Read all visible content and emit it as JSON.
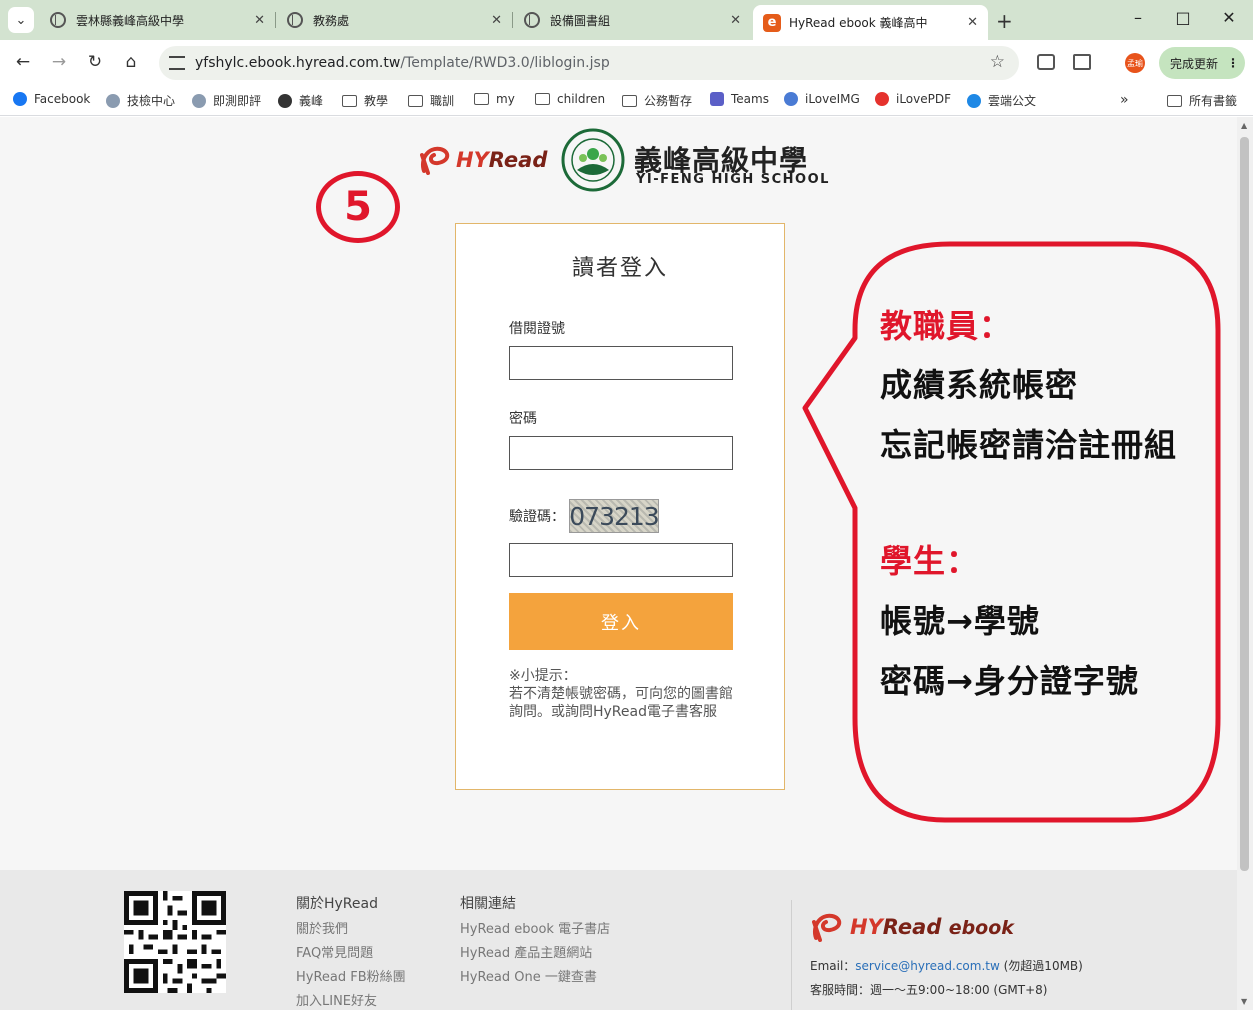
{
  "tabs": [
    {
      "label": "雲林縣義峰高級中學"
    },
    {
      "label": "教務處"
    },
    {
      "label": "設備圖書組"
    },
    {
      "label": "HyRead ebook 義峰高中",
      "icon": "e"
    }
  ],
  "window_buttons": {
    "minimize": "–",
    "maximize": "□",
    "close": "✕"
  },
  "toolbar": {
    "url_host": "yfshylc.ebook.hyread.com.tw",
    "url_path": "/Template/RWD3.0/liblogin.jsp",
    "profile_initials": "孟瑜",
    "update_label": "完成更新"
  },
  "bookmarks": [
    {
      "label": "Facebook",
      "color": "#1877f2"
    },
    {
      "label": "技檢中心",
      "color": "#8a9bb0"
    },
    {
      "label": "即測即評",
      "color": "#8a9bb0"
    },
    {
      "label": "義峰",
      "color": "#333333"
    },
    {
      "label": "教學",
      "type": "folder"
    },
    {
      "label": "職訓",
      "type": "folder"
    },
    {
      "label": "my",
      "type": "folder"
    },
    {
      "label": "children",
      "type": "folder"
    },
    {
      "label": "公務暫存",
      "type": "folder"
    },
    {
      "label": "Teams",
      "color": "#5b5fc7"
    },
    {
      "label": "iLoveIMG",
      "color": "#4a7bd4"
    },
    {
      "label": "iLovePDF",
      "color": "#e5322d"
    },
    {
      "label": "雲端公文",
      "color": "#1e88e5"
    }
  ],
  "bookmarks_overflow": "»",
  "bookmarks_all": "所有書籤",
  "header": {
    "hyread_hy": "HY",
    "hyread_read": "Read",
    "school_name": "義峰高級中學",
    "school_name_en": "YI-FENG HIGH SCHOOL",
    "step_number": "5"
  },
  "login": {
    "title": "讀者登入",
    "card_label": "借閱證號",
    "card_value": "",
    "password_label": "密碼",
    "password_value": "",
    "captcha_label": "驗證碼：",
    "captcha_code": "073213",
    "captcha_value": "",
    "submit_label": "登入",
    "tip_title": "※小提示：",
    "tip_body": "若不清楚帳號密碼，可向您的圖書館詢問。或詢問HyRead電子書客服"
  },
  "callout": {
    "staff_heading": "教職員：",
    "staff_line1": "成績系統帳密",
    "staff_line2": "忘記帳密請洽註冊組",
    "student_heading": "學生：",
    "student_line1": "帳號→學號",
    "student_line2": "密碼→身分證字號"
  },
  "footer": {
    "about_heading": "關於HyRead",
    "about_links": [
      "關於我們",
      "FAQ常見問題",
      "HyRead FB粉絲團",
      "加入LINE好友"
    ],
    "related_heading": "相關連結",
    "related_links": [
      "HyRead ebook 電子書店",
      "HyRead 產品主題網站",
      "HyRead One 一鍵查書"
    ],
    "brand_hy": "HY",
    "brand_read": "Read",
    "brand_ebook": "ebook",
    "email_label": "Email：",
    "email": "service@hyread.com.tw",
    "email_note": "(勿超過10MB)",
    "hours": "客服時間：週一～五9:00~18:00 (GMT+8)"
  },
  "colors": {
    "accent_orange": "#f4a33d",
    "annotation_red": "#e0162b",
    "tab_strip": "#d3e3d0"
  }
}
